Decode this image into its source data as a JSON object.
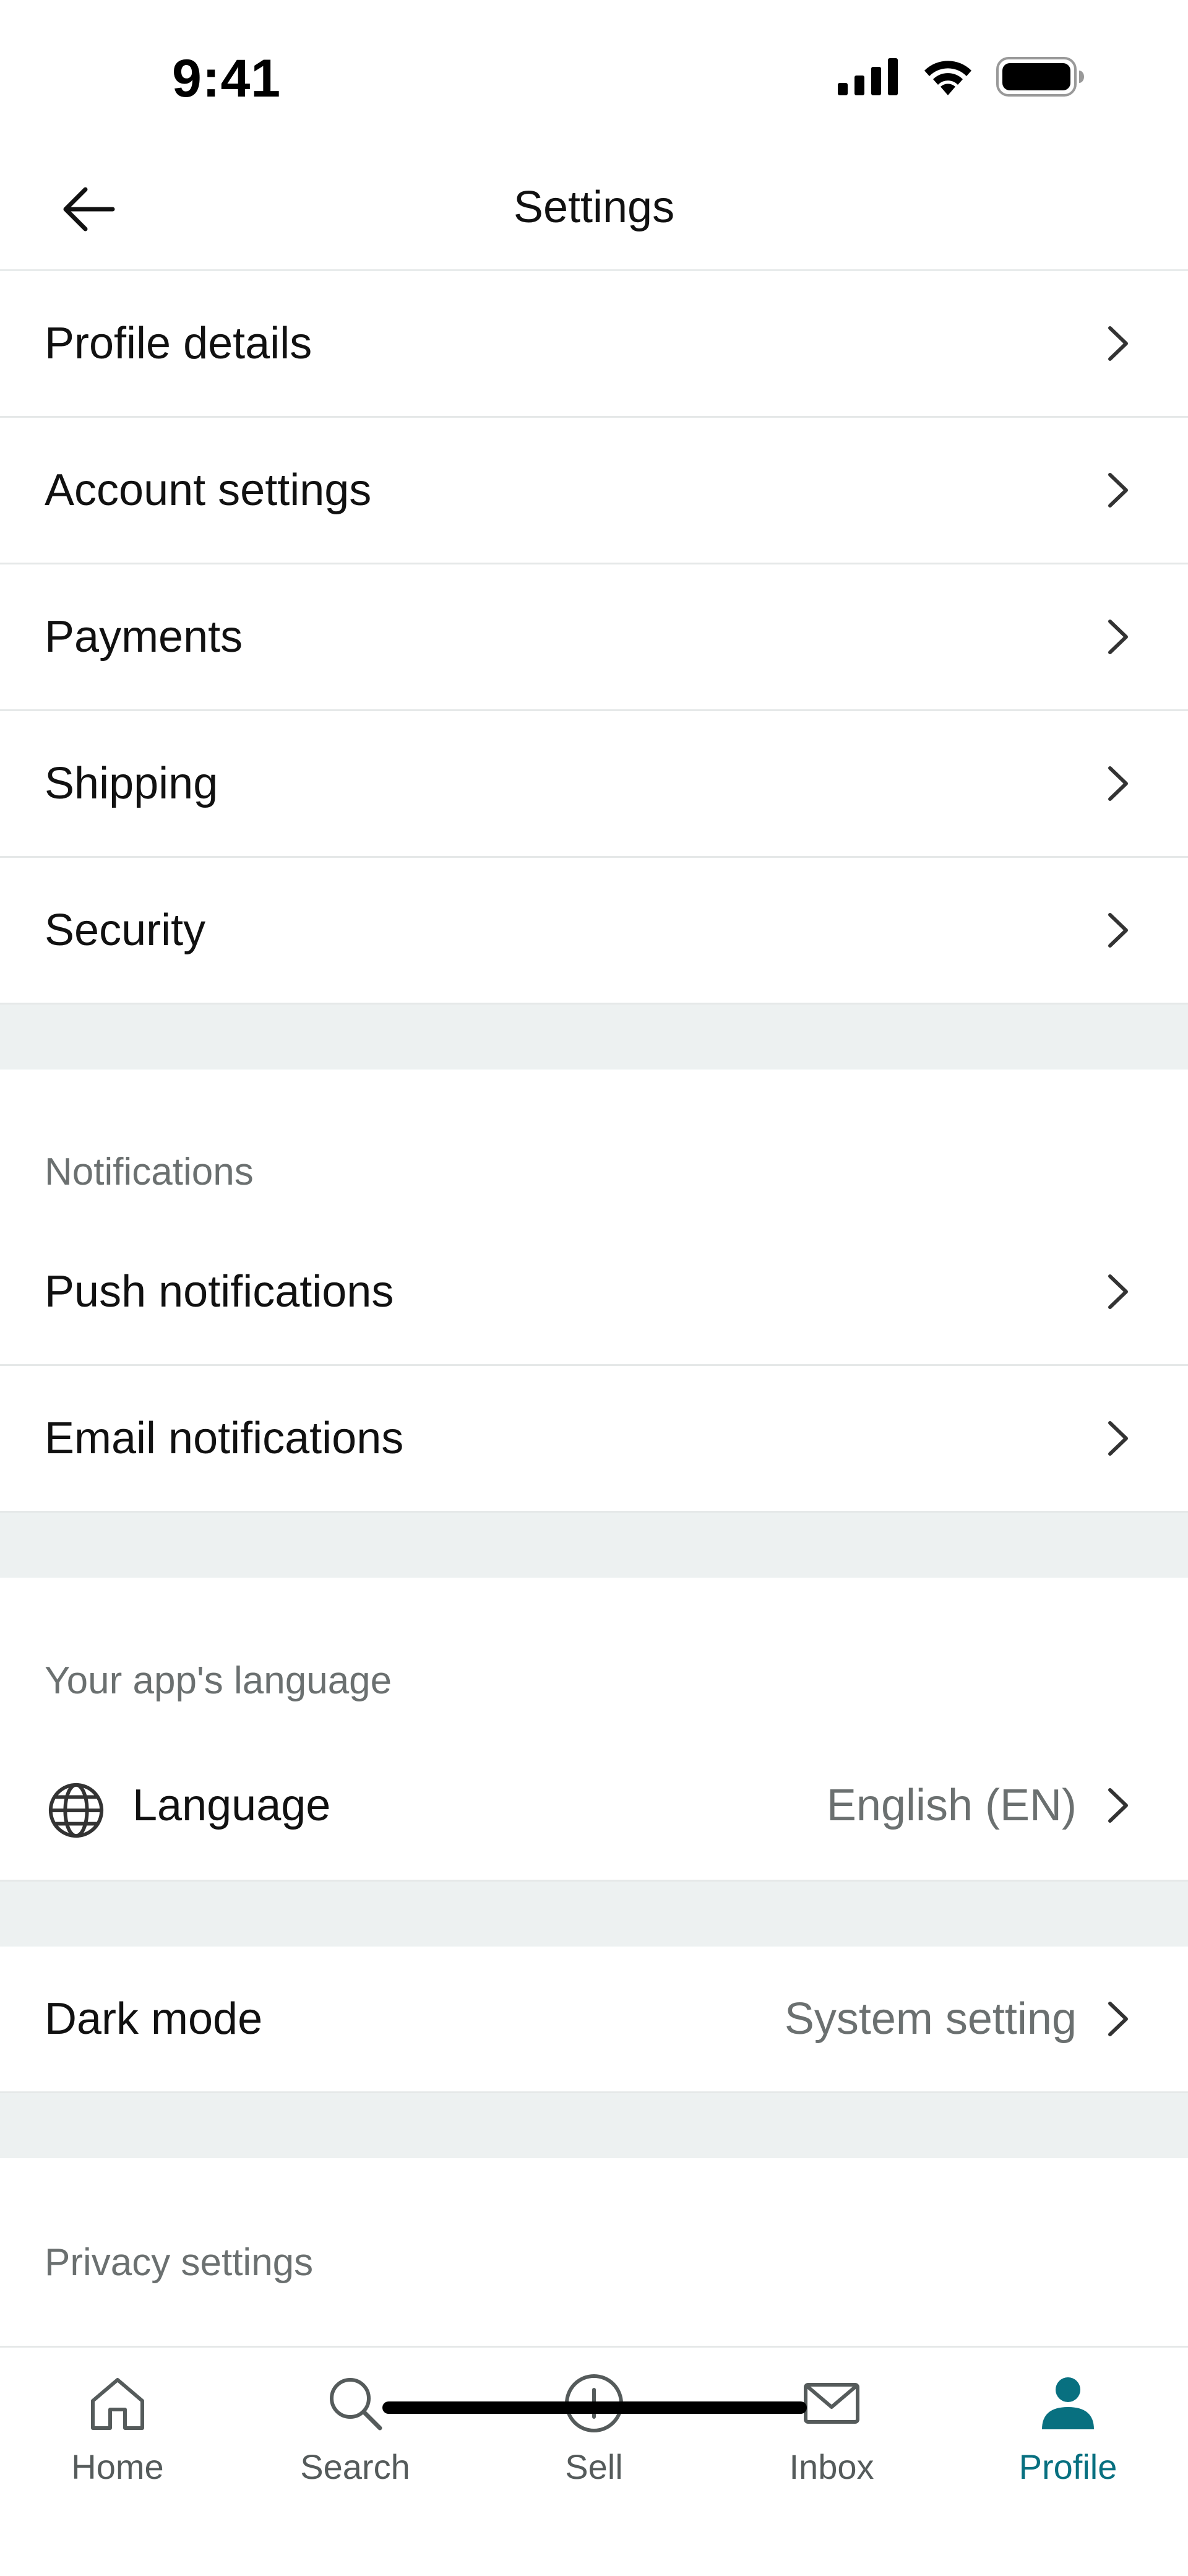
{
  "status_bar": {
    "time": "9:41"
  },
  "header": {
    "title": "Settings"
  },
  "account_items": [
    {
      "label": "Profile details"
    },
    {
      "label": "Account settings"
    },
    {
      "label": "Payments"
    },
    {
      "label": "Shipping"
    },
    {
      "label": "Security"
    }
  ],
  "notifications": {
    "heading": "Notifications",
    "items": [
      {
        "label": "Push notifications"
      },
      {
        "label": "Email notifications"
      }
    ]
  },
  "language_section": {
    "heading": "Your app's language",
    "item": {
      "label": "Language",
      "value": "English (EN)",
      "icon": "globe-icon"
    }
  },
  "dark_mode": {
    "label": "Dark mode",
    "value": "System setting"
  },
  "privacy": {
    "heading": "Privacy settings"
  },
  "tab_bar": {
    "active": "Profile",
    "tabs": [
      {
        "label": "Home",
        "icon": "home-icon"
      },
      {
        "label": "Search",
        "icon": "search-icon"
      },
      {
        "label": "Sell",
        "icon": "plus-circle-icon"
      },
      {
        "label": "Inbox",
        "icon": "mail-icon"
      },
      {
        "label": "Profile",
        "icon": "person-icon"
      }
    ]
  },
  "colors": {
    "accent": "#087080",
    "section_gap": "#edf1f1",
    "secondary_text": "#6b7070"
  }
}
